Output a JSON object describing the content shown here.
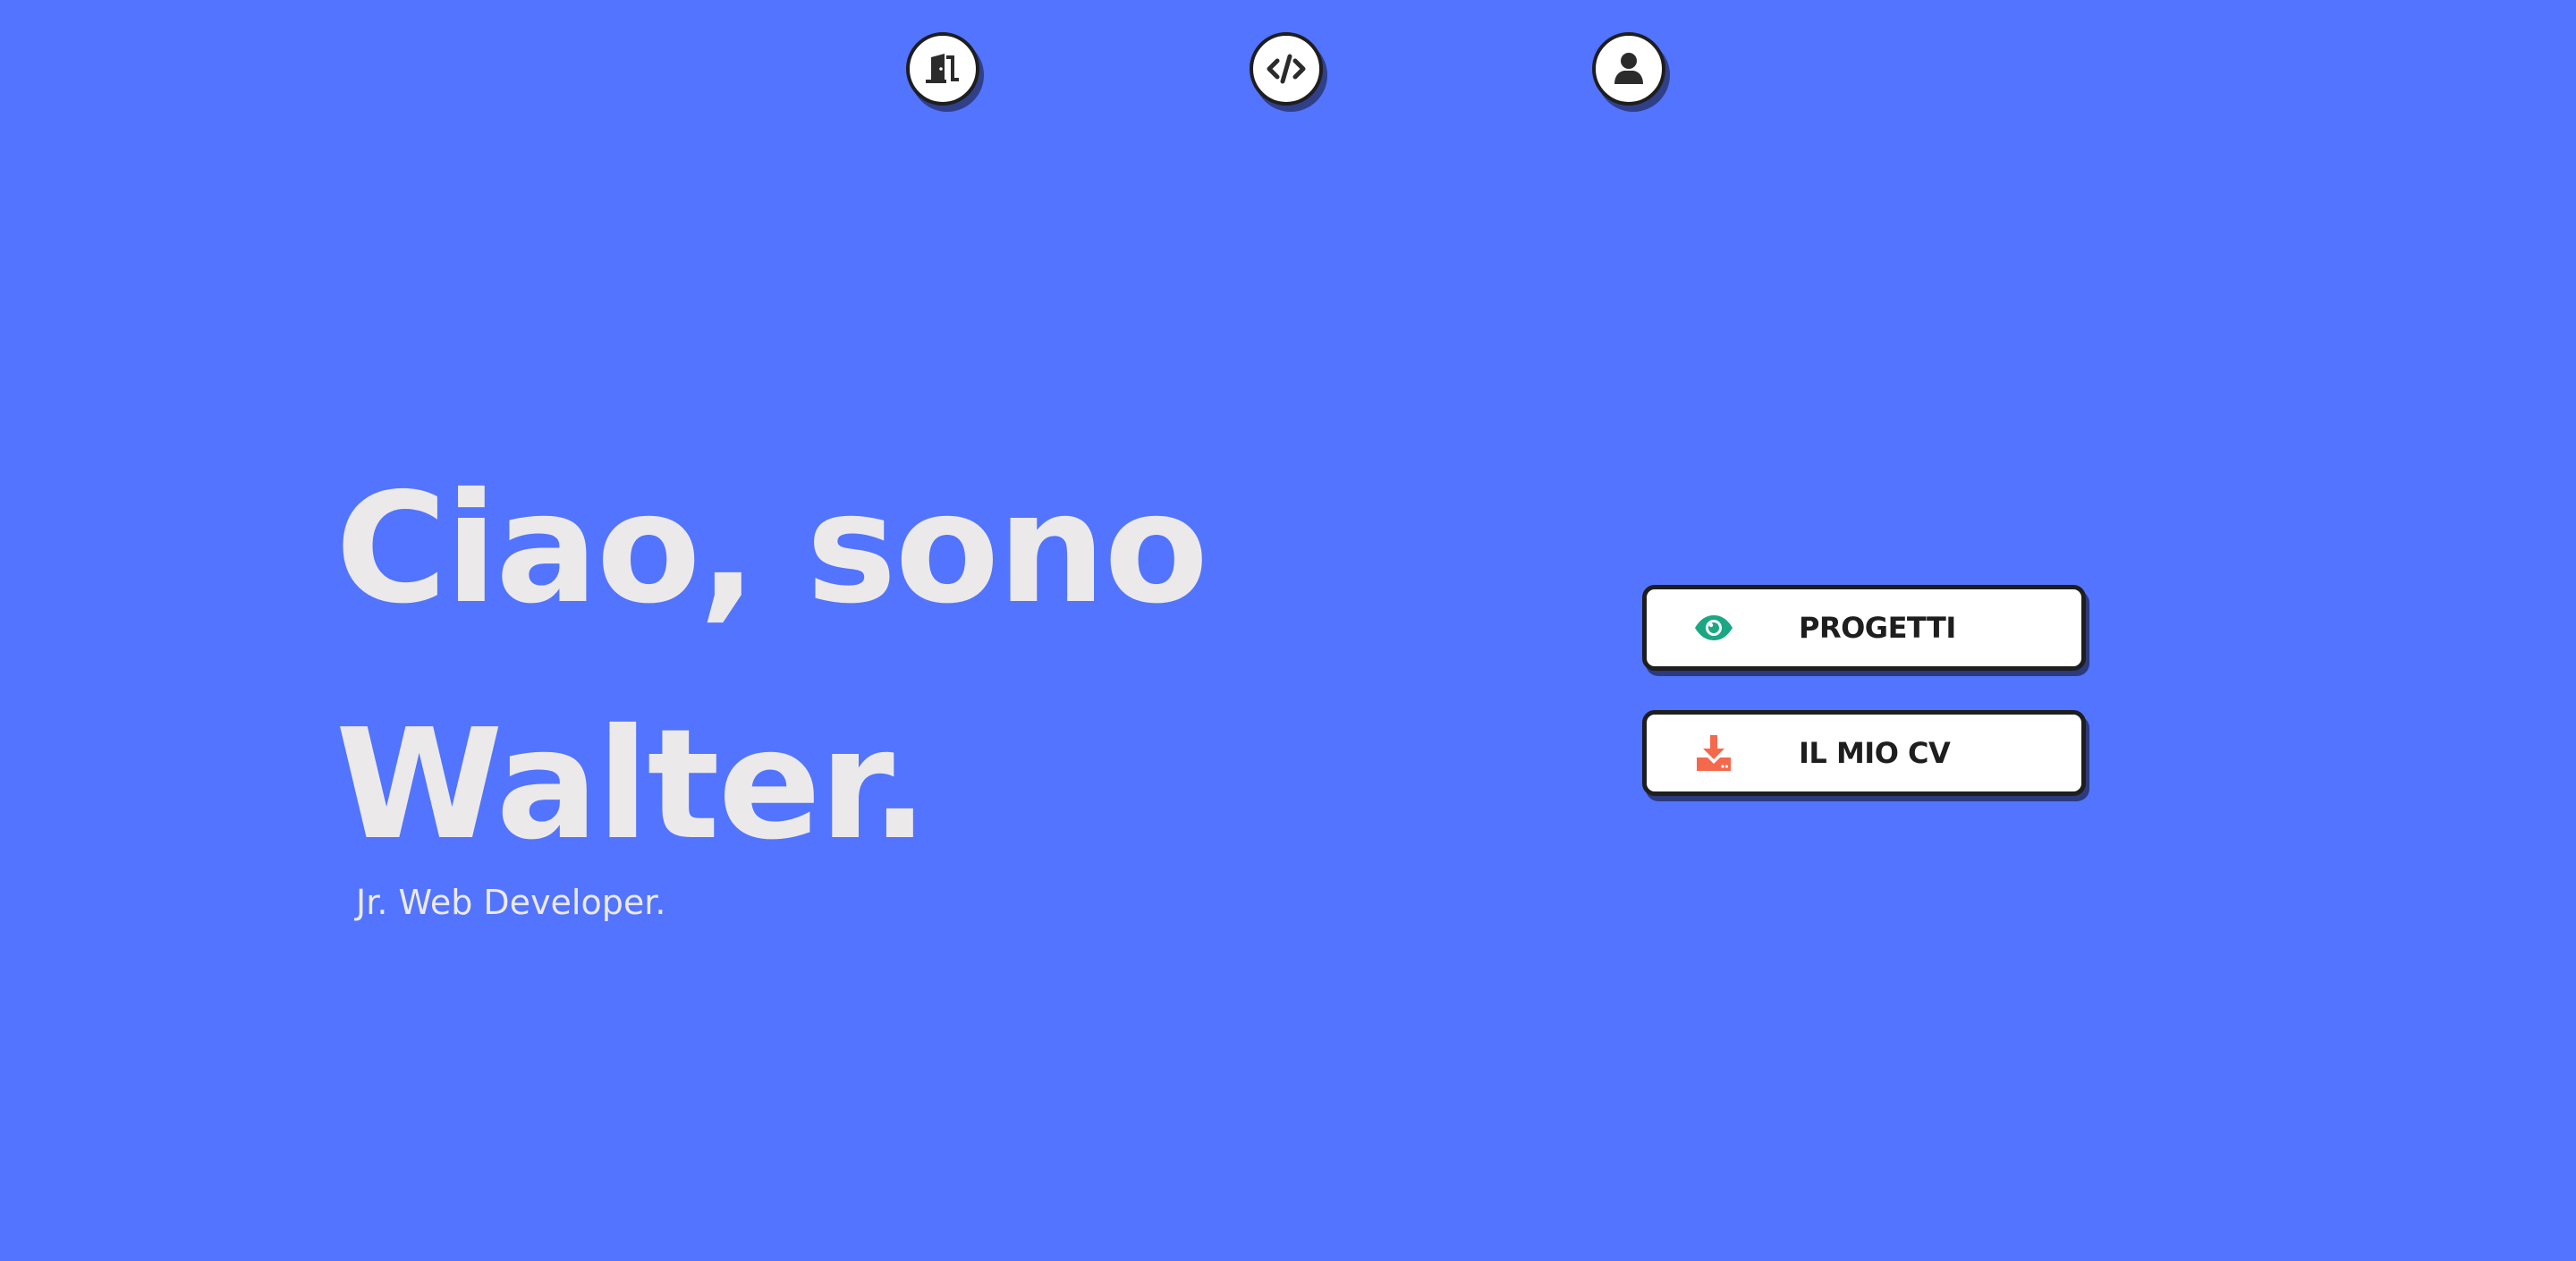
{
  "nav": {
    "items": [
      {
        "icon": "door-open-icon"
      },
      {
        "icon": "code-icon"
      },
      {
        "icon": "user-icon"
      }
    ]
  },
  "hero": {
    "title_line1": "Ciao, sono",
    "title_line2": "Walter.",
    "subtitle": "Jr. Web Developer."
  },
  "actions": {
    "projects": {
      "label": "PROGETTI",
      "icon": "eye-icon",
      "icon_color": "#1BA784"
    },
    "cv": {
      "label": "IL MIO CV",
      "icon": "download-icon",
      "icon_color": "#F4694C"
    }
  },
  "colors": {
    "background": "#5274FF",
    "hero_text": "#ECE9EA",
    "button_bg": "#FFFFFF",
    "button_text": "#1E1E1E"
  }
}
